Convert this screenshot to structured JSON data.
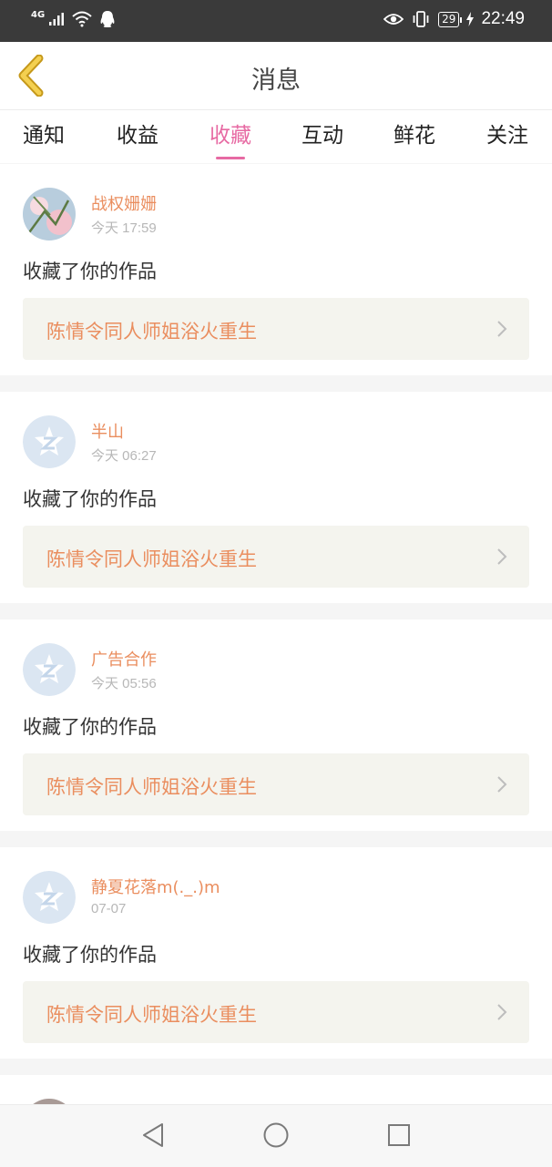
{
  "status_bar": {
    "network": "4G",
    "battery": "29",
    "time": "22:49"
  },
  "header": {
    "title": "消息"
  },
  "tabs": [
    {
      "label": "通知"
    },
    {
      "label": "收益"
    },
    {
      "label": "收藏",
      "active": true
    },
    {
      "label": "互动"
    },
    {
      "label": "鲜花"
    },
    {
      "label": "关注"
    }
  ],
  "colors": {
    "accent_pink": "#e76aa3",
    "name_orange": "#ea8e5f",
    "status_bar": "#3a3a3a",
    "back_arrow": "#e6bb2b"
  },
  "messages": [
    {
      "user": "战权姗姗",
      "time": "今天 17:59",
      "action": "收藏了你的作品",
      "work": "陈情令同人师姐浴火重生",
      "avatar": "photo-avatar"
    },
    {
      "user": "半山",
      "time": "今天 06:27",
      "action": "收藏了你的作品",
      "work": "陈情令同人师姐浴火重生",
      "avatar": "default-z-avatar"
    },
    {
      "user": "广告合作",
      "time": "今天 05:56",
      "action": "收藏了你的作品",
      "work": "陈情令同人师姐浴火重生",
      "avatar": "default-z-avatar"
    },
    {
      "user": "静夏花落m(._.)m",
      "time": "07-07",
      "action": "收藏了你的作品",
      "work": "陈情令同人师姐浴火重生",
      "avatar": "default-z-avatar"
    }
  ]
}
